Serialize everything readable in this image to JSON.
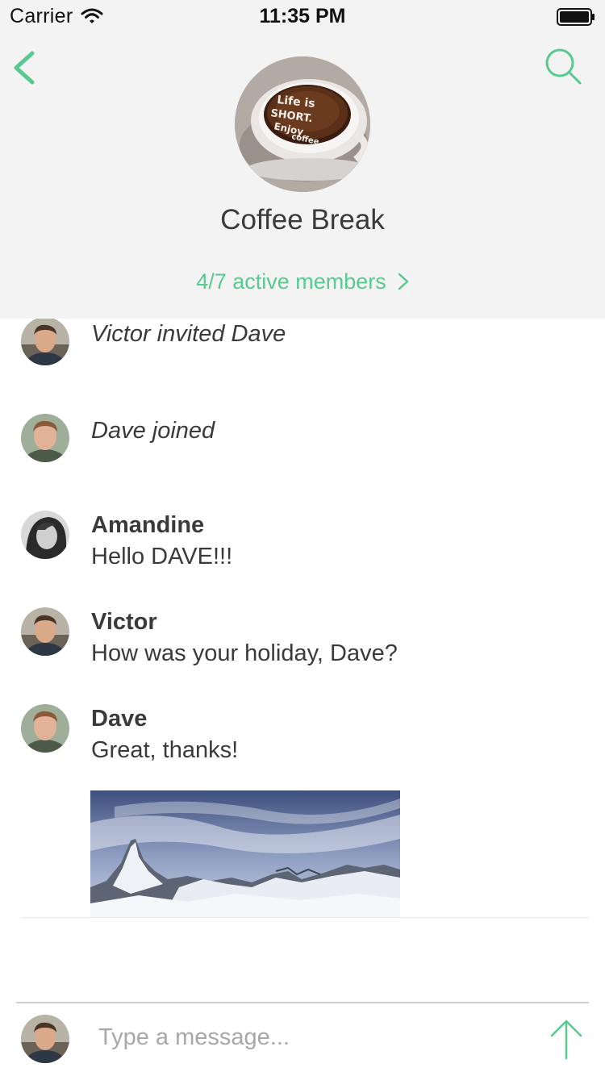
{
  "status_bar": {
    "carrier": "Carrier",
    "time": "11:35 PM",
    "wifi_icon": "wifi-icon",
    "battery_icon": "battery-icon"
  },
  "header": {
    "back_icon": "chevron-left-icon",
    "search_icon": "search-icon",
    "room_name": "Coffee Break",
    "members_label": "4/7 active members",
    "members_chevron_icon": "chevron-right-icon"
  },
  "timeline": {
    "events": [
      {
        "type": "notice",
        "user": "Victor",
        "text": "Victor invited Dave"
      },
      {
        "type": "notice",
        "user": "Dave",
        "text": "Dave joined"
      },
      {
        "type": "message",
        "sender": "Amandine",
        "body": "Hello DAVE!!!"
      },
      {
        "type": "message",
        "sender": "Victor",
        "body": "How was your holiday, Dave?"
      },
      {
        "type": "message",
        "sender": "Dave",
        "body": "Great, thanks!"
      }
    ]
  },
  "composer": {
    "placeholder": "Type a message...",
    "value": "",
    "send_icon": "arrow-up-icon"
  },
  "colors": {
    "accent": "#59c98f",
    "header_background": "#f3f3f3",
    "text": "#3a3a3a",
    "placeholder": "#a8a8a8"
  }
}
